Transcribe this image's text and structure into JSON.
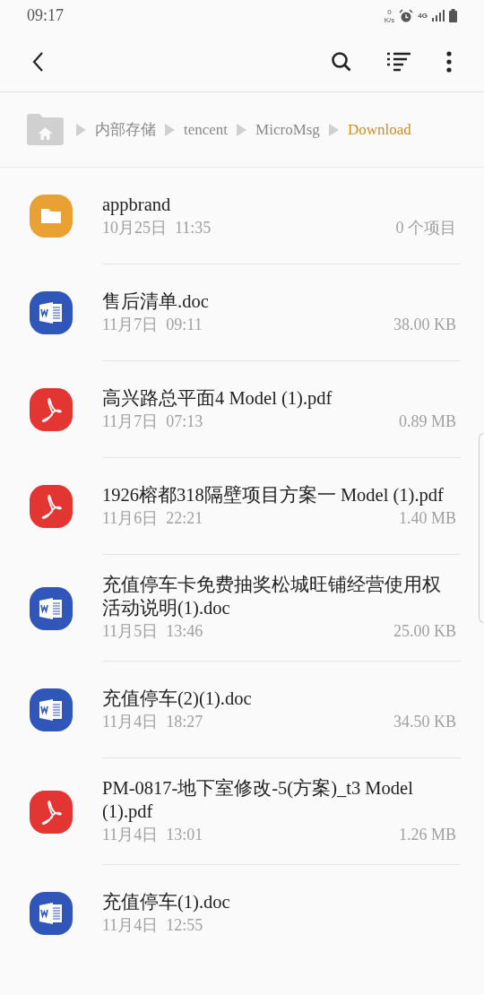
{
  "status_bar": {
    "time": "09:17",
    "speed_value": "0",
    "speed_unit": "K/s",
    "network": "4G"
  },
  "breadcrumb": [
    {
      "label": "内部存储",
      "selected": false
    },
    {
      "label": "tencent",
      "selected": false
    },
    {
      "label": "MicroMsg",
      "selected": false
    },
    {
      "label": "Download",
      "selected": true
    }
  ],
  "files": [
    {
      "kind": "folder",
      "name": "appbrand",
      "date": "10月25日",
      "time": "11:35",
      "size": "0 个项目"
    },
    {
      "kind": "word",
      "name": "售后清单.doc",
      "date": "11月7日",
      "time": "09:11",
      "size": "38.00 KB"
    },
    {
      "kind": "pdf",
      "name": "高兴路总平面4 Model (1).pdf",
      "date": "11月7日",
      "time": "07:13",
      "size": "0.89 MB"
    },
    {
      "kind": "pdf",
      "name": "1926榕都318隔壁项目方案一 Model (1).pdf",
      "date": "11月6日",
      "time": "22:21",
      "size": "1.40 MB"
    },
    {
      "kind": "word",
      "name": "充值停车卡免费抽奖松城旺铺经营使用权活动说明(1).doc",
      "date": "11月5日",
      "time": "13:46",
      "size": "25.00 KB"
    },
    {
      "kind": "word",
      "name": "充值停车(2)(1).doc",
      "date": "11月4日",
      "time": "18:27",
      "size": "34.50 KB"
    },
    {
      "kind": "pdf",
      "name": "PM-0817-地下室修改-5(方案)_t3 Model (1).pdf",
      "date": "11月4日",
      "time": "13:01",
      "size": "1.26 MB"
    },
    {
      "kind": "word",
      "name": "充值停车(1).doc",
      "date": "11月4日",
      "time": "12:55"
    }
  ]
}
